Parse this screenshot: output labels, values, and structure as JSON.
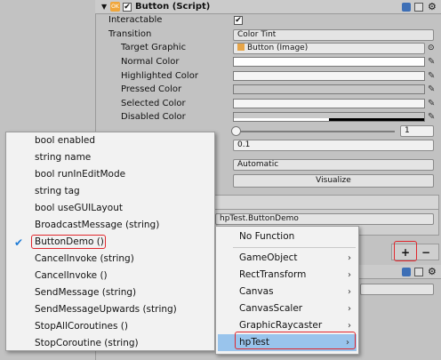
{
  "component": {
    "title": "Button (Script)",
    "icon": "script-icon",
    "enabled": true
  },
  "props": {
    "interactable": "Interactable",
    "transition": "Transition",
    "transition_value": "Color Tint",
    "target_graphic": "Target Graphic",
    "target_graphic_value": "Button (Image)",
    "normal_color": "Normal Color",
    "highlighted_color": "Highlighted Color",
    "pressed_color": "Pressed Color",
    "selected_color": "Selected Color",
    "disabled_color": "Disabled Color",
    "fade_duration_value": "0.1",
    "navigation_value": "Automatic",
    "visualize": "Visualize",
    "multiplier_value": "1",
    "onclick_method": "hpTest.ButtonDemo",
    "add": "+",
    "remove": "−"
  },
  "colors": {
    "normal": "#ffffff",
    "highlighted": "#f5f5f5",
    "pressed": "#c8c8c8",
    "selected": "#f5f5f5",
    "disabled": "#c8c8c8"
  },
  "left_menu": {
    "items": [
      "bool enabled",
      "string name",
      "bool runInEditMode",
      "string tag",
      "bool useGUILayout",
      "BroadcastMessage (string)",
      "ButtonDemo ()",
      "CancelInvoke (string)",
      "CancelInvoke ()",
      "SendMessage (string)",
      "SendMessageUpwards (string)",
      "StopAllCoroutines ()",
      "StopCoroutine (string)"
    ],
    "checked_index": 6
  },
  "right_menu": {
    "items": [
      "No Function",
      "GameObject",
      "RectTransform",
      "Canvas",
      "CanvasScaler",
      "GraphicRaycaster",
      "hpTest"
    ],
    "submenu_arrow": "›"
  }
}
